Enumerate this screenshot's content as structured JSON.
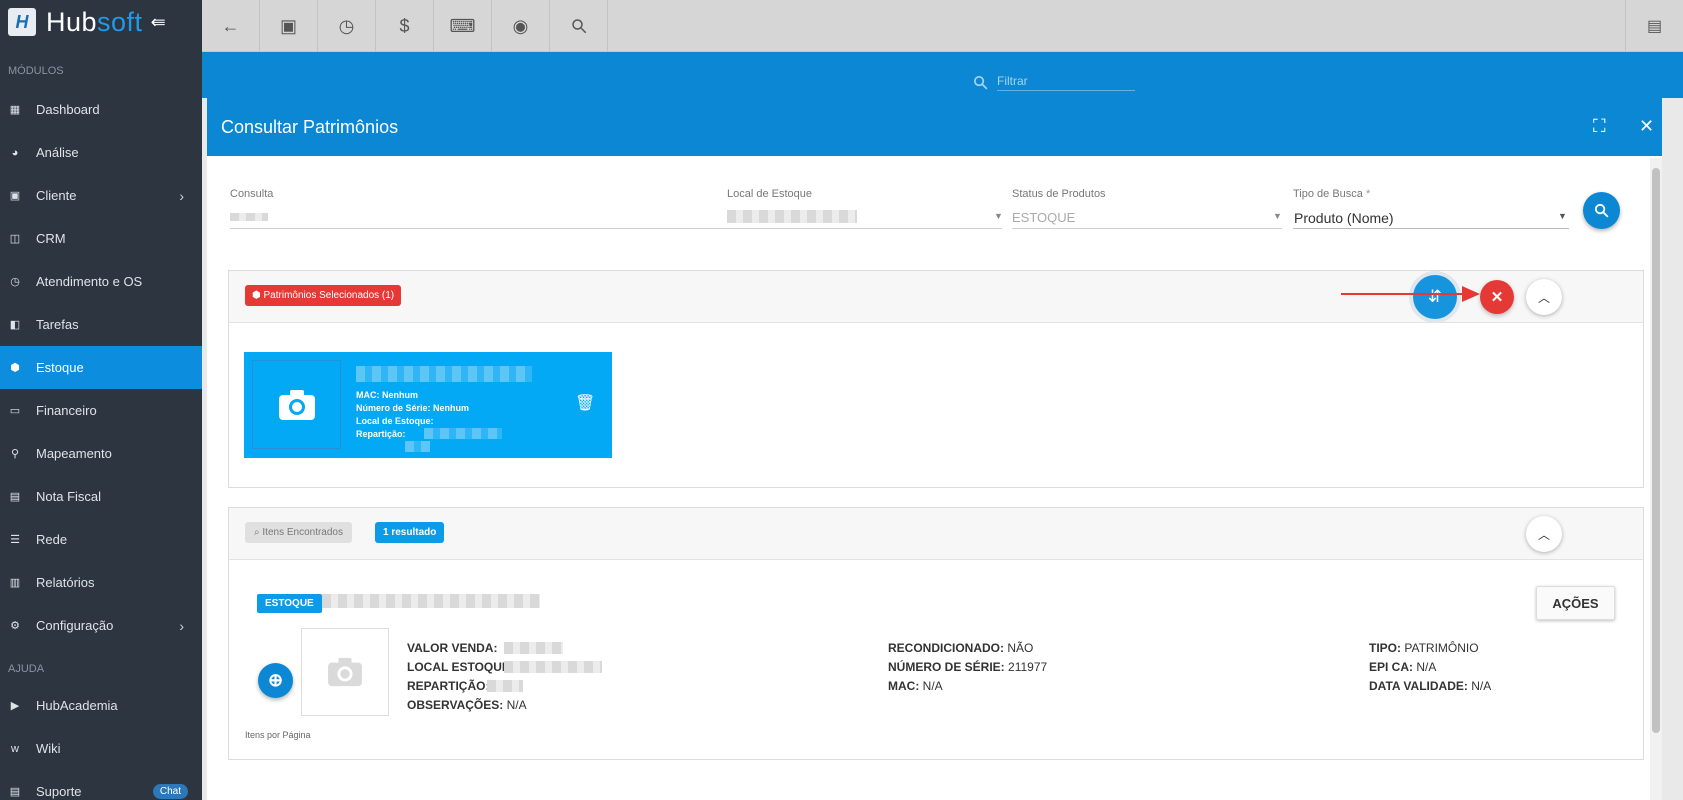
{
  "app": {
    "logo_text_a": "Hub",
    "logo_text_b": "soft",
    "logo_letter": "H"
  },
  "sidebar": {
    "section_modules": "MÓDULOS",
    "section_help": "AJUDA",
    "items": [
      {
        "label": "Dashboard"
      },
      {
        "label": "Análise"
      },
      {
        "label": "Cliente"
      },
      {
        "label": "CRM"
      },
      {
        "label": "Atendimento e OS"
      },
      {
        "label": "Tarefas"
      },
      {
        "label": "Estoque"
      },
      {
        "label": "Financeiro"
      },
      {
        "label": "Mapeamento"
      },
      {
        "label": "Nota Fiscal"
      },
      {
        "label": "Rede"
      },
      {
        "label": "Relatórios"
      },
      {
        "label": "Configuração"
      }
    ],
    "help_items": [
      {
        "label": "HubAcademia"
      },
      {
        "label": "Wiki"
      },
      {
        "label": "Suporte",
        "badge": "Chat"
      }
    ]
  },
  "topbar": {
    "filter_placeholder": "Filtrar"
  },
  "modal": {
    "title": "Consultar Patrimônios",
    "fields": {
      "consulta_label": "Consulta",
      "local_label": "Local de Estoque",
      "status_label": "Status de Produtos",
      "status_value": "ESTOQUE",
      "tipo_label": "Tipo de Busca",
      "tipo_required": "*",
      "tipo_value": "Produto (Nome)"
    },
    "selected_panel": {
      "tag": "Patrimônios Selecionados (1)",
      "card": {
        "mac": "MAC: Nenhum",
        "serial": "Número de Série: Nenhum",
        "local": "Local de Estoque:",
        "reparticao": "Repartição:"
      }
    },
    "results_panel": {
      "search_tag": "Itens Encontrados",
      "count_tag": "1 resultado",
      "item": {
        "status_tag": "ESTOQUE",
        "actions_label": "AÇÕES",
        "col1": {
          "valor_venda": "VALOR VENDA:",
          "local_estoque": "LOCAL ESTOQUE:",
          "reparticao": "REPARTIÇÃO:",
          "observacoes": "OBSERVAÇÕES:",
          "observacoes_value": "N/A"
        },
        "col2": {
          "recondicionado": "RECONDICIONADO:",
          "recondicionado_value": "NÃO",
          "numero_serie": "NÚMERO DE SÉRIE:",
          "numero_serie_value": "211977",
          "mac": "MAC:",
          "mac_value": "N/A"
        },
        "col3": {
          "tipo": "TIPO:",
          "tipo_value": "PATRIMÔNIO",
          "epi_ca": "EPI CA:",
          "epi_ca_value": "N/A",
          "data_validade": "DATA VALIDADE:",
          "data_validade_value": "N/A"
        }
      }
    },
    "per_page_label": "Itens por Página"
  },
  "colors": {
    "primary": "#0b87d4",
    "sidebar": "#2d3540",
    "danger": "#e53935",
    "card": "#03a9f4"
  }
}
